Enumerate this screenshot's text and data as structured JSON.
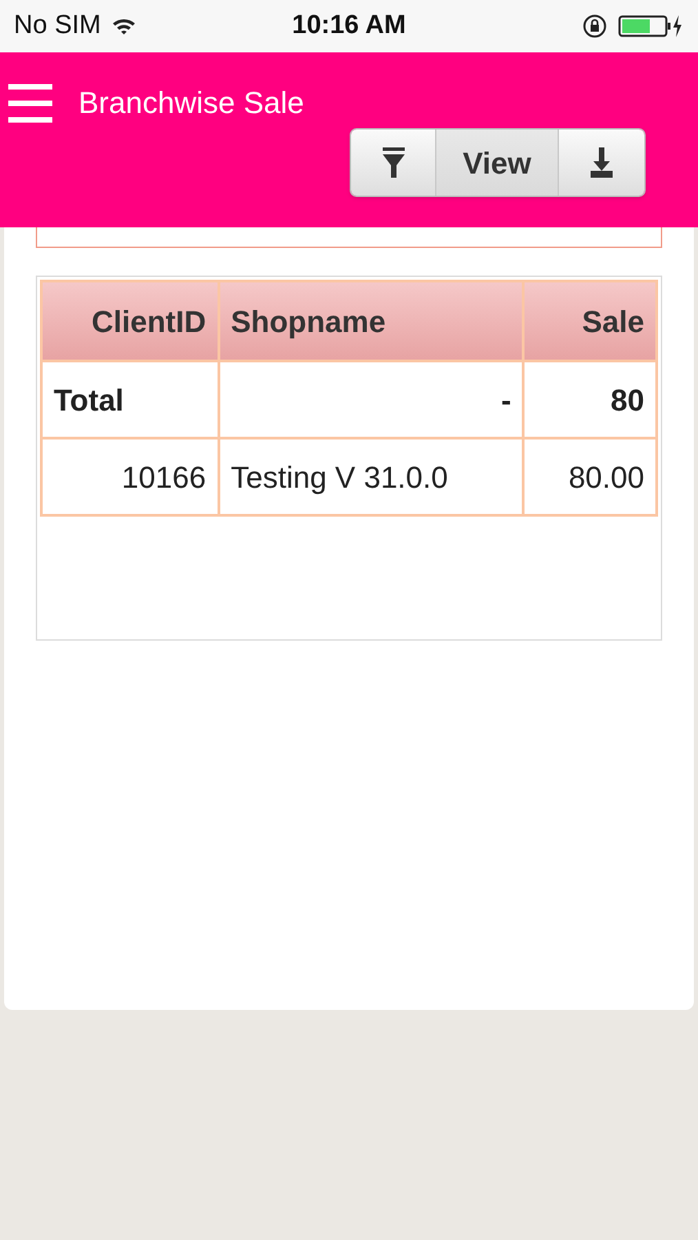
{
  "status_bar": {
    "carrier": "No SIM",
    "time": "10:16 AM"
  },
  "header": {
    "title": "Branchwise Sale"
  },
  "toolbar": [
    {
      "kind": "filter"
    },
    {
      "kind": "label",
      "label": "View"
    },
    {
      "kind": "download"
    }
  ],
  "table": {
    "columns": [
      "ClientID",
      "Shopname",
      "Sale"
    ],
    "rows": [
      {
        "kind": "total",
        "cells": [
          "Total",
          "-",
          "80"
        ]
      },
      {
        "kind": "data",
        "cells": [
          "10166",
          "Testing V 31.0.0",
          "80.00"
        ]
      }
    ]
  }
}
